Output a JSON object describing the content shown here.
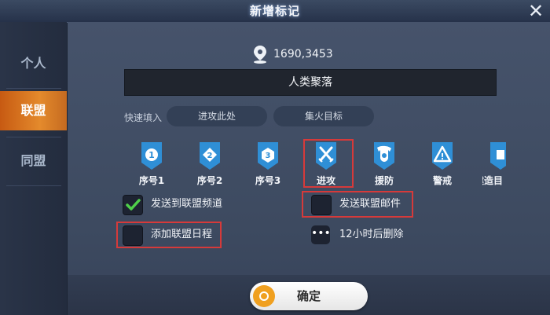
{
  "window": {
    "title": "新增标记"
  },
  "sidebar": {
    "tabs": [
      {
        "label": "个人",
        "active": false
      },
      {
        "label": "联盟",
        "active": true
      },
      {
        "label": "同盟",
        "active": false
      }
    ]
  },
  "location": {
    "coords": "1690,3453",
    "name": "人类聚落"
  },
  "quick_fill": {
    "label": "快速填入",
    "buttons": [
      "进攻此处",
      "集火目标"
    ]
  },
  "markers": [
    {
      "label": "序号1",
      "badge": "1",
      "icon": "number-one-icon",
      "selected": false
    },
    {
      "label": "序号2",
      "badge": "2",
      "icon": "number-two-icon",
      "selected": false
    },
    {
      "label": "序号3",
      "badge": "3",
      "icon": "number-three-icon",
      "selected": false
    },
    {
      "label": "进攻",
      "icon": "crossed-swords-icon",
      "selected": true
    },
    {
      "label": "援防",
      "icon": "shield-icon",
      "selected": false
    },
    {
      "label": "警戒",
      "badge": "!",
      "icon": "warning-icon",
      "selected": false
    },
    {
      "label": "建造目",
      "icon": "build-icon",
      "selected": false
    }
  ],
  "options": {
    "send_channel": {
      "label": "发送到联盟频道",
      "checked": true
    },
    "send_mail": {
      "label": "发送联盟邮件",
      "checked": false
    },
    "add_schedule": {
      "label": "添加联盟日程",
      "checked": false
    },
    "auto_delete": {
      "label": "12小时后删除"
    }
  },
  "confirm": {
    "label": "确定"
  },
  "colors": {
    "accent": "#e48a2c",
    "marker_blue": "#2f8fd6",
    "highlight": "#d63a3a"
  }
}
